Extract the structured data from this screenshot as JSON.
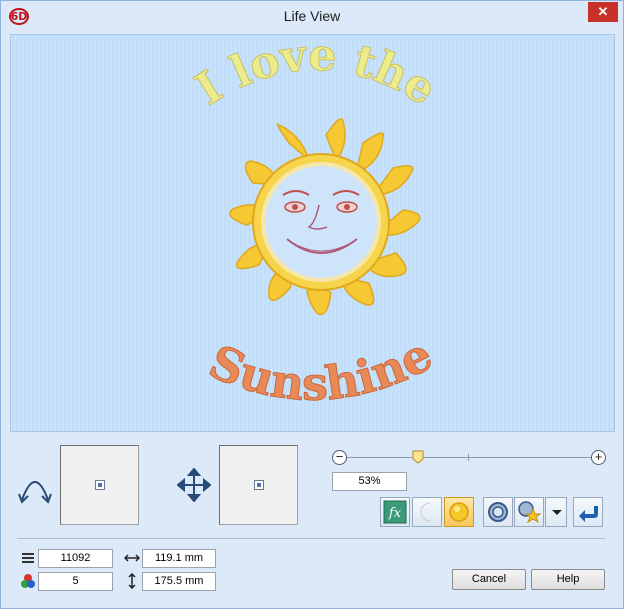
{
  "window": {
    "title": "Life View",
    "app_icon": "6D"
  },
  "design": {
    "top_text": "I love the",
    "bottom_text": "Sunshine",
    "top_text_color": "#ecec8c",
    "bottom_text_color": "#e98958",
    "sun_color": "#f5c834"
  },
  "zoom": {
    "value": "53%",
    "level": 0.29
  },
  "stats": {
    "stitches": "11092",
    "colors": "5",
    "width": "119.1 mm",
    "height": "175.5 mm"
  },
  "buttons": {
    "cancel": "Cancel",
    "help": "Help"
  },
  "icons": {
    "rotate": "rotate-arc-icon",
    "move": "move-arrows-icon",
    "effects": "fx-icon",
    "night": "moon-icon",
    "day": "sun-icon",
    "fabric": "hoop-icon",
    "favorites": "hoop-star-icon",
    "back": "return-arrow-icon",
    "stitch_count": "stitch-lines-icon",
    "color_count": "color-dots-icon",
    "width": "horizontal-arrow-icon",
    "height": "vertical-arrow-icon"
  }
}
